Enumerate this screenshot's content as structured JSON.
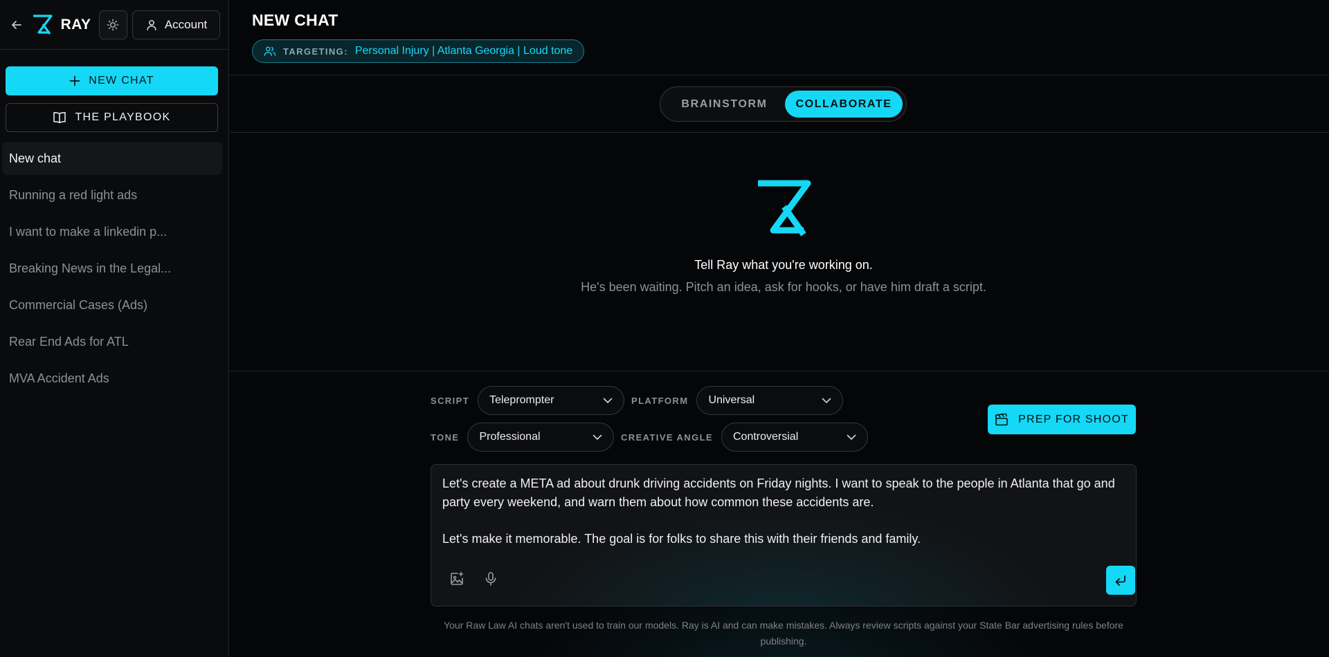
{
  "app": {
    "name": "RAY"
  },
  "sidebar": {
    "account_label": "Account",
    "new_chat_label": "NEW CHAT",
    "playbook_label": "THE PLAYBOOK",
    "chats": [
      {
        "label": "New chat",
        "active": true
      },
      {
        "label": "Running a red light ads"
      },
      {
        "label": "I want to make a linkedin p..."
      },
      {
        "label": "Breaking News in the Legal..."
      },
      {
        "label": "Commercial Cases (Ads)"
      },
      {
        "label": "Rear End Ads for ATL"
      },
      {
        "label": "MVA Accident Ads"
      }
    ]
  },
  "header": {
    "title": "NEW CHAT",
    "targeting_label": "TARGETING:",
    "targeting_value": "Personal Injury | Atlanta Georgia | Loud tone"
  },
  "modes": {
    "brainstorm": "BRAINSTORM",
    "collaborate": "COLLABORATE",
    "selected": "COLLABORATE"
  },
  "empty_state": {
    "title": "Tell Ray what you're working on.",
    "subtitle": "He's been waiting. Pitch an idea, ask for hooks, or have him draft a script."
  },
  "composer": {
    "script_label": "SCRIPT",
    "script_value": "Teleprompter",
    "platform_label": "PLATFORM",
    "platform_value": "Universal",
    "tone_label": "TONE",
    "tone_value": "Professional",
    "angle_label": "CREATIVE ANGLE",
    "angle_value": "Controversial",
    "prep_label": "PREP FOR SHOOT",
    "message": "Let's create a META ad about drunk driving accidents on Friday nights. I want to speak to the people in Atlanta that go and party every weekend, and warn them about how common these accidents are.\n\nLet's make it memorable. The goal is for folks to share this with their friends and family."
  },
  "disclaimer": "Your Raw Law AI chats aren't used to train our models. Ray is AI and can make mistakes. Always review scripts against your State Bar advertising rules before publishing.",
  "colors": {
    "accent": "#14d8f5",
    "background": "#050608",
    "sidebar": "#0a0b0d"
  }
}
